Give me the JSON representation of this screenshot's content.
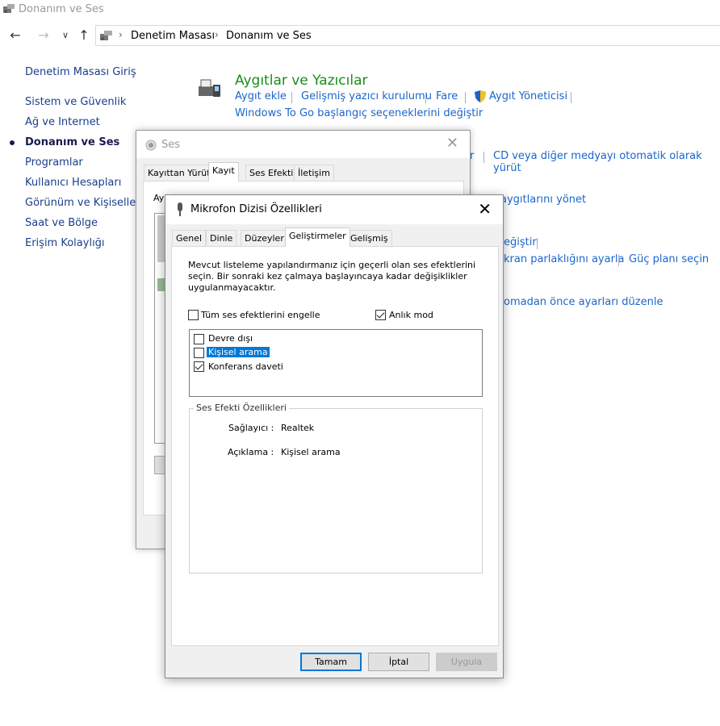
{
  "window": {
    "title": "Donanım ve Ses"
  },
  "address": {
    "crumbs": [
      "Denetim Masası",
      "Donanım ve Ses"
    ]
  },
  "sidebar": {
    "items": [
      {
        "label": "Denetim Masası Giriş"
      },
      {
        "label": "Sistem ve Güvenlik"
      },
      {
        "label": "Ağ ve Internet"
      },
      {
        "label": "Donanım ve Ses",
        "active": true
      },
      {
        "label": "Programlar"
      },
      {
        "label": "Kullanıcı Hesapları"
      },
      {
        "label": "Görünüm ve Kişiselleştir"
      },
      {
        "label": "Saat ve Bölge"
      },
      {
        "label": "Erişim Kolaylığı"
      }
    ]
  },
  "main": {
    "section_title": "Aygıtlar ve Yazıcılar",
    "links": {
      "aygit_ekle": "Aygıt ekle",
      "yazici": "Gelişmiş yazıcı kurulumu",
      "fare": "Fare",
      "aygit_yoneticisi": "Aygıt Yöneticisi",
      "windows_to_go": "Windows To Go başlangıç seçeneklerini değiştir",
      "partial_r": "r",
      "cd": "CD veya diğer medyayı otomatik olarak yürüt",
      "aygitlari_yonet": "aygıtlarını yönet",
      "degistir": "eğiştir",
      "parlaklik": "kran parlaklığını ayarla",
      "guc_plani": "Güç planı seçin",
      "ayarlar": "omadan önce ayarları düzenle"
    }
  },
  "ses": {
    "title": "Ses",
    "tabs": [
      "Kayıttan Yürüt",
      "Kayıt",
      "Ses Efekti",
      "İletişim"
    ],
    "partial_text": "Ay"
  },
  "mik": {
    "title": "Mikrofon Dizisi Özellikleri",
    "tabs": [
      "Genel",
      "Dinle",
      "Düzeyler",
      "Geliştirmeler",
      "Gelişmiş"
    ],
    "description": "Mevcut listeleme yapılandırmanız için geçerli olan ses efektlerini seçin. Bir sonraki kez çalmaya başlayıncaya kadar değişiklikler uygulanmayacaktır.",
    "disable_all": {
      "label": "Tüm ses efektlerini engelle",
      "checked": false
    },
    "instant_mode": {
      "label": "Anlık mod",
      "checked": true
    },
    "effects": [
      {
        "label": "Devre dışı",
        "checked": false
      },
      {
        "label": "Kişisel arama",
        "checked": false,
        "selected": true
      },
      {
        "label": "Konferans daveti",
        "checked": true
      }
    ],
    "properties": {
      "group_title": "Ses Efekti Özellikleri",
      "provider_label": "Sağlayıcı :",
      "provider_value": "Realtek",
      "description_label": "Açıklama :",
      "description_value": "Kişisel arama"
    },
    "buttons": {
      "ok": "Tamam",
      "cancel": "İptal",
      "apply": "Uygula"
    }
  }
}
